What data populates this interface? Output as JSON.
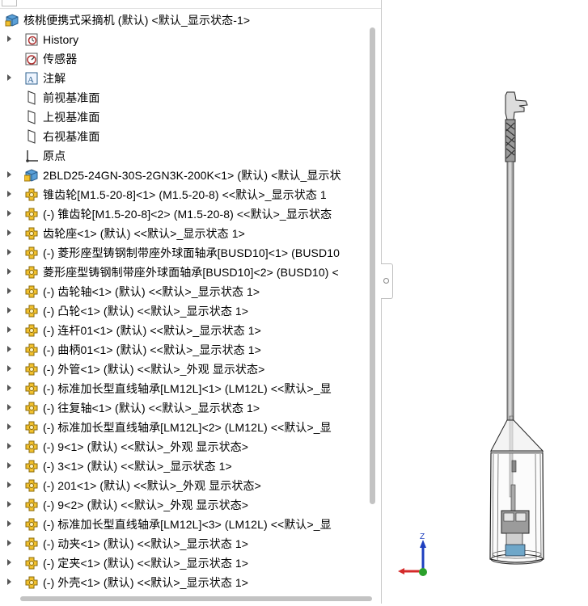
{
  "tree": {
    "root": {
      "label": "核桃便携式采摘机 (默认) <默认_显示状态-1>",
      "icon": "assembly-icon"
    },
    "items": [
      {
        "label": "History",
        "icon": "history-icon",
        "expandable": true
      },
      {
        "label": "传感器",
        "icon": "sensor-icon",
        "expandable": false
      },
      {
        "label": "注解",
        "icon": "annotation-icon",
        "expandable": true
      },
      {
        "label": "前视基准面",
        "icon": "plane-icon",
        "expandable": false
      },
      {
        "label": "上视基准面",
        "icon": "plane-icon",
        "expandable": false
      },
      {
        "label": "右视基准面",
        "icon": "plane-icon",
        "expandable": false
      },
      {
        "label": "原点",
        "icon": "origin-icon",
        "expandable": false
      },
      {
        "label": "2BLD25-24GN-30S-2GN3K-200K<1> (默认) <默认_显示状",
        "icon": "subassembly-icon",
        "expandable": true
      },
      {
        "label": "锥齿轮[M1.5-20-8]<1> (M1.5-20-8) <<默认>_显示状态 1",
        "icon": "part-icon",
        "expandable": true
      },
      {
        "label": "(-) 锥齿轮[M1.5-20-8]<2> (M1.5-20-8) <<默认>_显示状态",
        "icon": "part-icon",
        "expandable": true
      },
      {
        "label": "齿轮座<1> (默认) <<默认>_显示状态 1>",
        "icon": "part-icon",
        "expandable": true
      },
      {
        "label": "(-) 菱形座型铸钢制带座外球面轴承[BUSD10]<1> (BUSD10",
        "icon": "part-icon",
        "expandable": true
      },
      {
        "label": "菱形座型铸钢制带座外球面轴承[BUSD10]<2> (BUSD10) <",
        "icon": "part-icon",
        "expandable": true
      },
      {
        "label": "(-) 齿轮轴<1> (默认) <<默认>_显示状态 1>",
        "icon": "part-icon",
        "expandable": true
      },
      {
        "label": "(-) 凸轮<1> (默认) <<默认>_显示状态 1>",
        "icon": "part-icon",
        "expandable": true
      },
      {
        "label": "(-) 连杆01<1> (默认) <<默认>_显示状态 1>",
        "icon": "part-icon",
        "expandable": true
      },
      {
        "label": "(-) 曲柄01<1> (默认) <<默认>_显示状态 1>",
        "icon": "part-icon",
        "expandable": true
      },
      {
        "label": "(-) 外管<1> (默认) <<默认>_外观 显示状态>",
        "icon": "part-icon",
        "expandable": true
      },
      {
        "label": "(-) 标准加长型直线轴承[LM12L]<1> (LM12L) <<默认>_显",
        "icon": "part-icon",
        "expandable": true
      },
      {
        "label": "(-) 往复轴<1> (默认) <<默认>_显示状态 1>",
        "icon": "part-icon",
        "expandable": true
      },
      {
        "label": "(-) 标准加长型直线轴承[LM12L]<2> (LM12L) <<默认>_显",
        "icon": "part-icon",
        "expandable": true
      },
      {
        "label": "(-) 9<1> (默认) <<默认>_外观 显示状态>",
        "icon": "part-icon",
        "expandable": true
      },
      {
        "label": "(-) 3<1> (默认) <<默认>_显示状态 1>",
        "icon": "part-icon",
        "expandable": true
      },
      {
        "label": "(-) 201<1> (默认) <<默认>_外观 显示状态>",
        "icon": "part-icon",
        "expandable": true
      },
      {
        "label": "(-) 9<2> (默认) <<默认>_外观 显示状态>",
        "icon": "part-icon",
        "expandable": true
      },
      {
        "label": "(-) 标准加长型直线轴承[LM12L]<3> (LM12L) <<默认>_显",
        "icon": "part-icon",
        "expandable": true
      },
      {
        "label": "(-) 动夹<1> (默认) <<默认>_显示状态 1>",
        "icon": "part-icon",
        "expandable": true
      },
      {
        "label": "(-) 定夹<1> (默认) <<默认>_显示状态 1>",
        "icon": "part-icon",
        "expandable": true
      },
      {
        "label": "(-) 外壳<1> (默认) <<默认>_显示状态 1>",
        "icon": "part-icon",
        "expandable": true
      }
    ]
  },
  "triad": {
    "x": "X",
    "y": "Y",
    "z": "Z",
    "x_color": "#d42a2a",
    "y_color": "#2aa02a",
    "z_color": "#1e3fbf"
  },
  "colors": {
    "part_icon": "#f2c12e",
    "assembly_icon": "#5aa0d8"
  }
}
